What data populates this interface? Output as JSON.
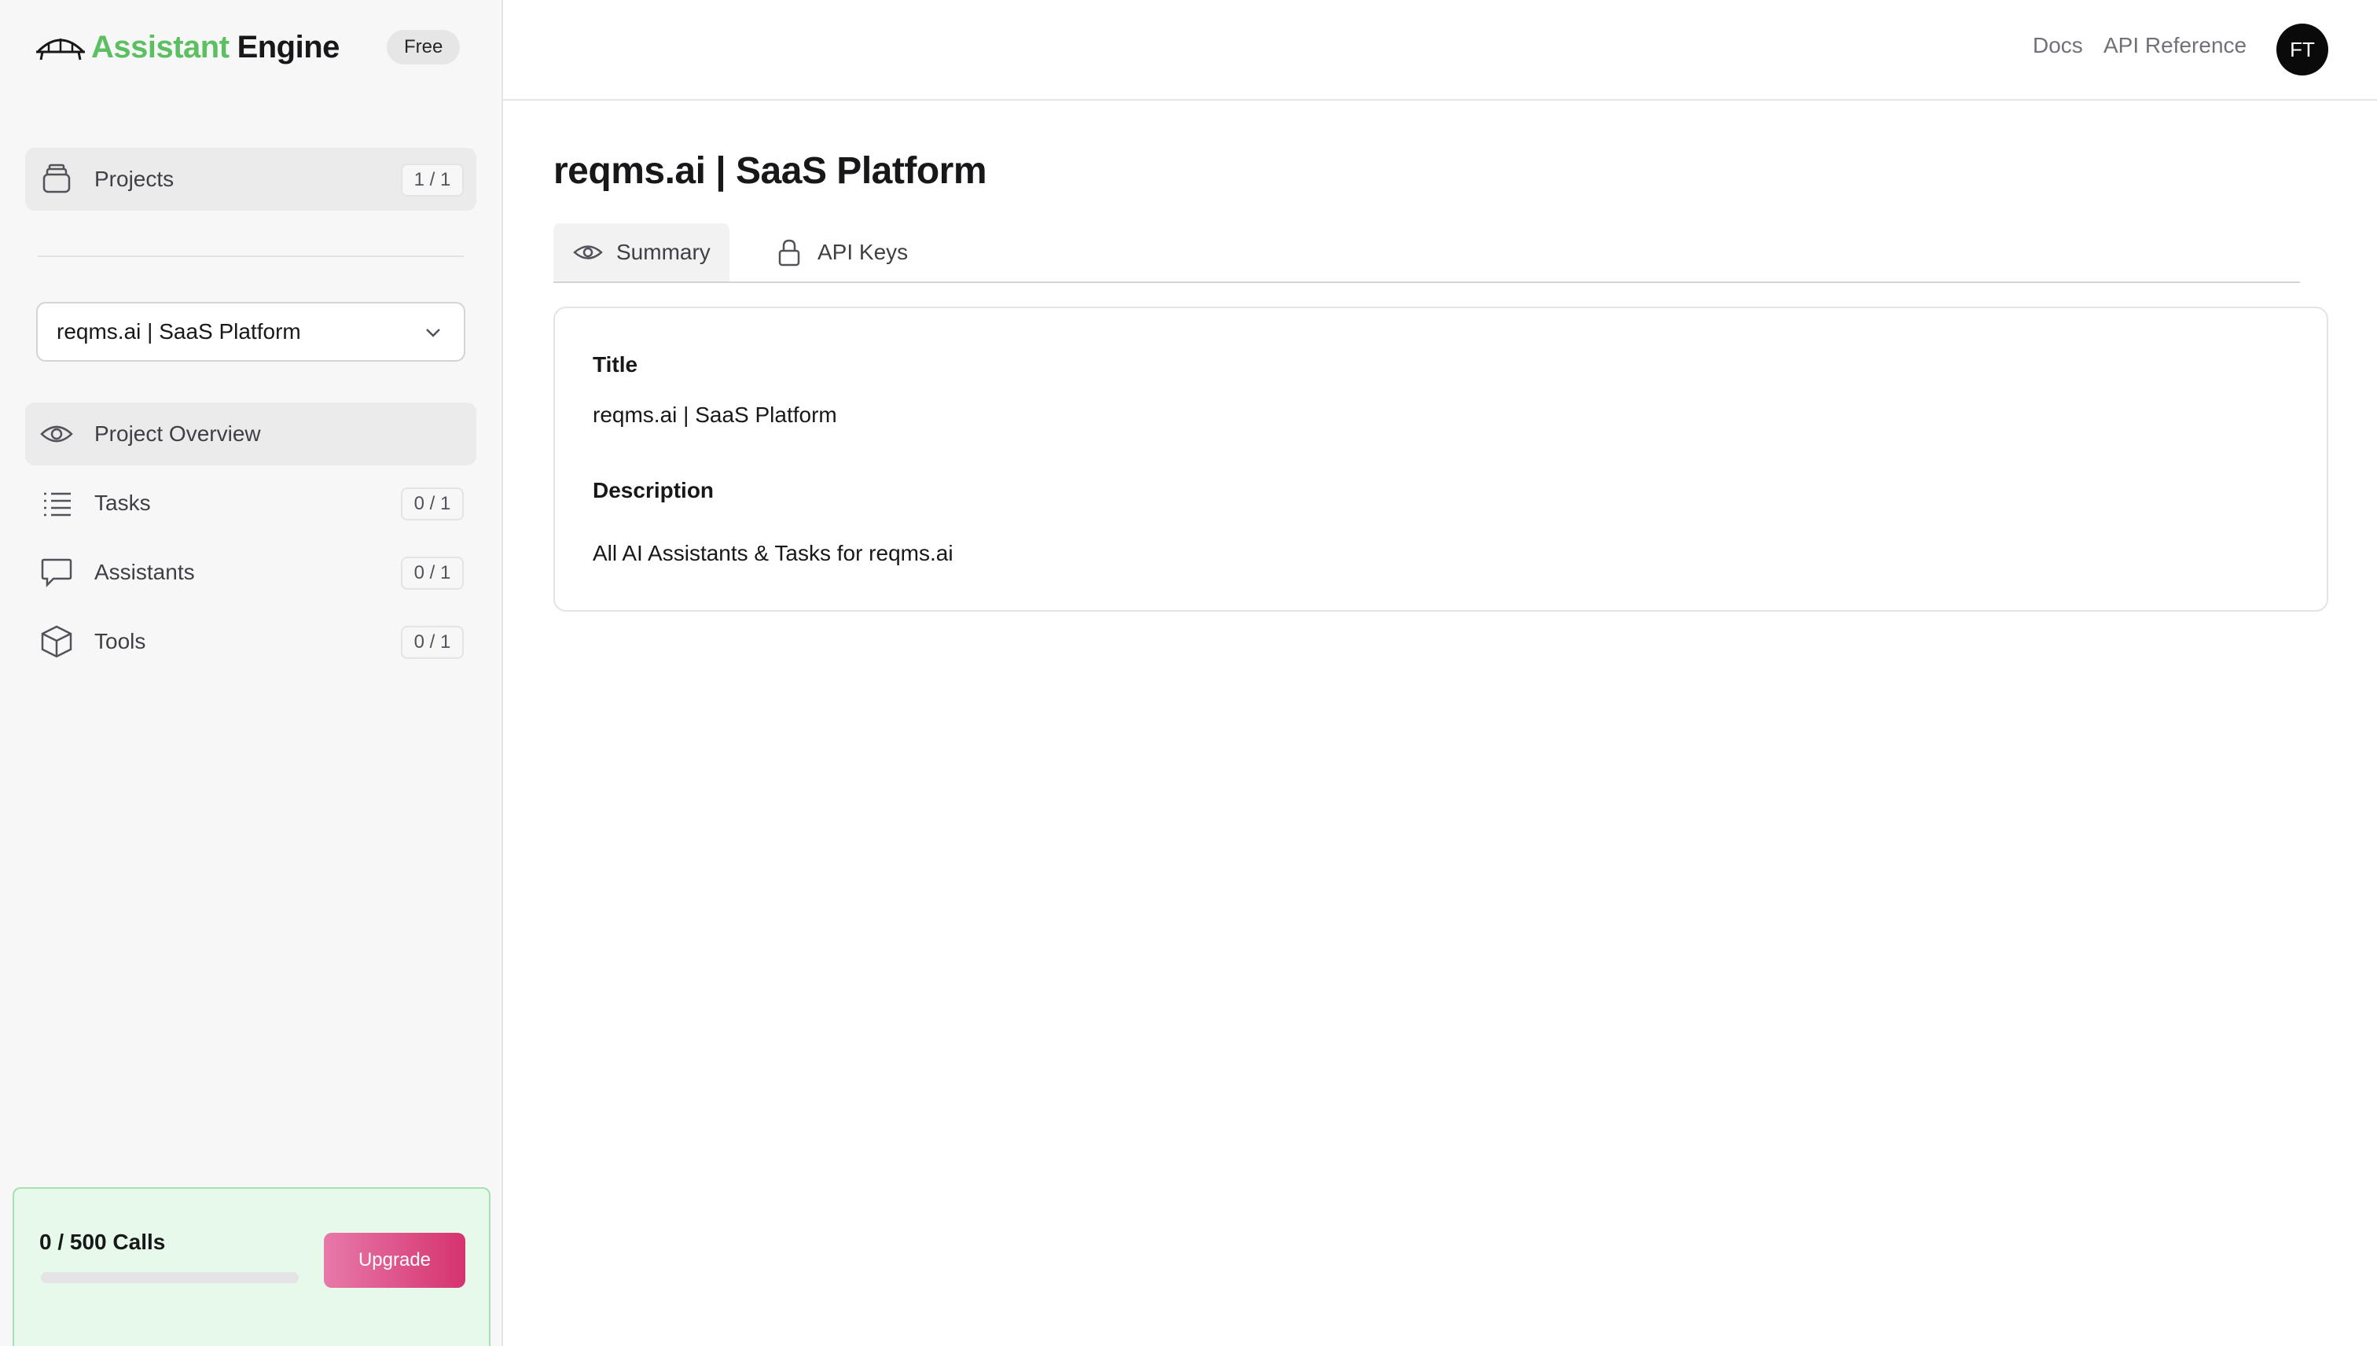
{
  "brand": {
    "name_accent": "Assistant",
    "name_rest": "Engine",
    "plan": "Free"
  },
  "sidebar": {
    "projects": {
      "label": "Projects",
      "count": "1 / 1"
    },
    "selected_project": "reqms.ai | SaaS Platform",
    "items": [
      {
        "label": "Project Overview",
        "icon": "eye-icon",
        "active": true
      },
      {
        "label": "Tasks",
        "icon": "list-icon",
        "count": "0 / 1"
      },
      {
        "label": "Assistants",
        "icon": "chat-icon",
        "count": "0 / 1"
      },
      {
        "label": "Tools",
        "icon": "cube-icon",
        "count": "0 / 1"
      }
    ],
    "usage": {
      "text": "0 / 500 Calls",
      "used": 0,
      "limit": 500,
      "upgrade_label": "Upgrade"
    }
  },
  "topbar": {
    "docs": "Docs",
    "api_reference": "API Reference",
    "avatar_initials": "FT"
  },
  "main": {
    "title": "reqms.ai | SaaS Platform",
    "tabs": [
      {
        "label": "Summary",
        "icon": "eye-icon",
        "active": true
      },
      {
        "label": "API Keys",
        "icon": "lock-icon",
        "active": false
      }
    ],
    "summary": {
      "title_label": "Title",
      "title_value": "reqms.ai | SaaS Platform",
      "description_label": "Description",
      "description_value": "All AI Assistants & Tasks for reqms.ai"
    }
  },
  "colors": {
    "brand_green": "#5cbf62",
    "upgrade_pink": "#d5336f",
    "usage_bg": "#e6f9ea"
  }
}
